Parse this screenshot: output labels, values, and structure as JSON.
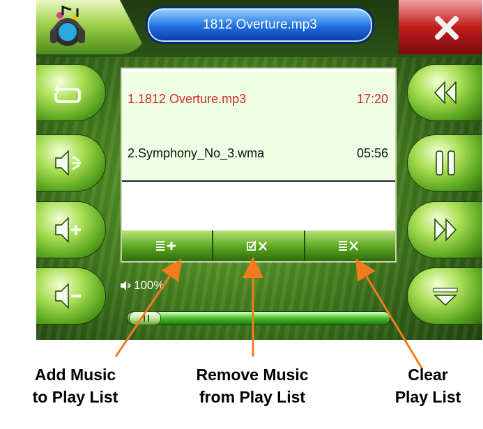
{
  "header": {
    "title": "1812 Overture.mp3",
    "logo_icon": "music-note-headphones-icon",
    "close_icon": "close-x-icon"
  },
  "left_buttons": [
    {
      "icon": "repeat-icon"
    },
    {
      "icon": "mute-speaker-icon"
    },
    {
      "icon": "volume-up-icon"
    },
    {
      "icon": "volume-down-icon"
    }
  ],
  "right_buttons": [
    {
      "icon": "previous-track-icon"
    },
    {
      "icon": "pause-icon"
    },
    {
      "icon": "next-track-icon"
    },
    {
      "icon": "collapse-menu-icon"
    }
  ],
  "playlist": {
    "tracks": [
      {
        "name": "1.1812 Overture.mp3",
        "duration": "17:20",
        "active": true
      },
      {
        "name": "2.Symphony_No_3.wma",
        "duration": "05:56",
        "active": false
      }
    ],
    "toolbar": [
      {
        "icon": "add-to-list-icon"
      },
      {
        "icon": "remove-checked-icon"
      },
      {
        "icon": "clear-list-icon"
      }
    ]
  },
  "volume": {
    "label": "100%",
    "icon": "speaker-icon"
  },
  "progress": {
    "position": 0.02
  },
  "annotations": {
    "add": {
      "line1": "Add Music",
      "line2": "to Play List"
    },
    "remove": {
      "line1": "Remove Music",
      "line2": "from Play List"
    },
    "clear": {
      "line1": "Clear",
      "line2": "Play List"
    }
  },
  "colors": {
    "accent_green": "#5aa51f",
    "active_track": "#d22a2a",
    "arrow": "#f47b20",
    "title_pill": "#1f6fe0",
    "close": "#c21c1c"
  }
}
